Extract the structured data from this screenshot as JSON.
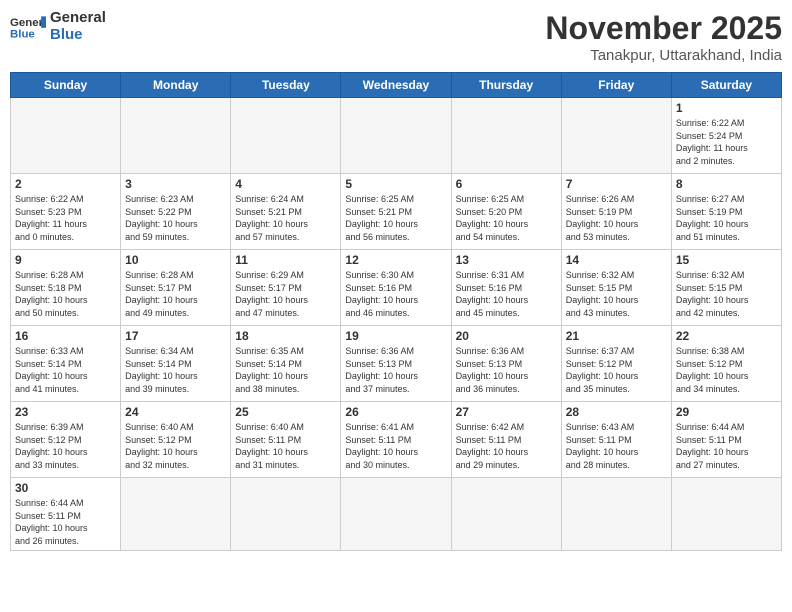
{
  "header": {
    "logo_general": "General",
    "logo_blue": "Blue",
    "month_title": "November 2025",
    "subtitle": "Tanakpur, Uttarakhand, India"
  },
  "weekdays": [
    "Sunday",
    "Monday",
    "Tuesday",
    "Wednesday",
    "Thursday",
    "Friday",
    "Saturday"
  ],
  "days": [
    {
      "num": "",
      "info": ""
    },
    {
      "num": "",
      "info": ""
    },
    {
      "num": "",
      "info": ""
    },
    {
      "num": "",
      "info": ""
    },
    {
      "num": "",
      "info": ""
    },
    {
      "num": "",
      "info": ""
    },
    {
      "num": "1",
      "info": "Sunrise: 6:22 AM\nSunset: 5:24 PM\nDaylight: 11 hours\nand 2 minutes."
    },
    {
      "num": "2",
      "info": "Sunrise: 6:22 AM\nSunset: 5:23 PM\nDaylight: 11 hours\nand 0 minutes."
    },
    {
      "num": "3",
      "info": "Sunrise: 6:23 AM\nSunset: 5:22 PM\nDaylight: 10 hours\nand 59 minutes."
    },
    {
      "num": "4",
      "info": "Sunrise: 6:24 AM\nSunset: 5:21 PM\nDaylight: 10 hours\nand 57 minutes."
    },
    {
      "num": "5",
      "info": "Sunrise: 6:25 AM\nSunset: 5:21 PM\nDaylight: 10 hours\nand 56 minutes."
    },
    {
      "num": "6",
      "info": "Sunrise: 6:25 AM\nSunset: 5:20 PM\nDaylight: 10 hours\nand 54 minutes."
    },
    {
      "num": "7",
      "info": "Sunrise: 6:26 AM\nSunset: 5:19 PM\nDaylight: 10 hours\nand 53 minutes."
    },
    {
      "num": "8",
      "info": "Sunrise: 6:27 AM\nSunset: 5:19 PM\nDaylight: 10 hours\nand 51 minutes."
    },
    {
      "num": "9",
      "info": "Sunrise: 6:28 AM\nSunset: 5:18 PM\nDaylight: 10 hours\nand 50 minutes."
    },
    {
      "num": "10",
      "info": "Sunrise: 6:28 AM\nSunset: 5:17 PM\nDaylight: 10 hours\nand 49 minutes."
    },
    {
      "num": "11",
      "info": "Sunrise: 6:29 AM\nSunset: 5:17 PM\nDaylight: 10 hours\nand 47 minutes."
    },
    {
      "num": "12",
      "info": "Sunrise: 6:30 AM\nSunset: 5:16 PM\nDaylight: 10 hours\nand 46 minutes."
    },
    {
      "num": "13",
      "info": "Sunrise: 6:31 AM\nSunset: 5:16 PM\nDaylight: 10 hours\nand 45 minutes."
    },
    {
      "num": "14",
      "info": "Sunrise: 6:32 AM\nSunset: 5:15 PM\nDaylight: 10 hours\nand 43 minutes."
    },
    {
      "num": "15",
      "info": "Sunrise: 6:32 AM\nSunset: 5:15 PM\nDaylight: 10 hours\nand 42 minutes."
    },
    {
      "num": "16",
      "info": "Sunrise: 6:33 AM\nSunset: 5:14 PM\nDaylight: 10 hours\nand 41 minutes."
    },
    {
      "num": "17",
      "info": "Sunrise: 6:34 AM\nSunset: 5:14 PM\nDaylight: 10 hours\nand 39 minutes."
    },
    {
      "num": "18",
      "info": "Sunrise: 6:35 AM\nSunset: 5:14 PM\nDaylight: 10 hours\nand 38 minutes."
    },
    {
      "num": "19",
      "info": "Sunrise: 6:36 AM\nSunset: 5:13 PM\nDaylight: 10 hours\nand 37 minutes."
    },
    {
      "num": "20",
      "info": "Sunrise: 6:36 AM\nSunset: 5:13 PM\nDaylight: 10 hours\nand 36 minutes."
    },
    {
      "num": "21",
      "info": "Sunrise: 6:37 AM\nSunset: 5:12 PM\nDaylight: 10 hours\nand 35 minutes."
    },
    {
      "num": "22",
      "info": "Sunrise: 6:38 AM\nSunset: 5:12 PM\nDaylight: 10 hours\nand 34 minutes."
    },
    {
      "num": "23",
      "info": "Sunrise: 6:39 AM\nSunset: 5:12 PM\nDaylight: 10 hours\nand 33 minutes."
    },
    {
      "num": "24",
      "info": "Sunrise: 6:40 AM\nSunset: 5:12 PM\nDaylight: 10 hours\nand 32 minutes."
    },
    {
      "num": "25",
      "info": "Sunrise: 6:40 AM\nSunset: 5:11 PM\nDaylight: 10 hours\nand 31 minutes."
    },
    {
      "num": "26",
      "info": "Sunrise: 6:41 AM\nSunset: 5:11 PM\nDaylight: 10 hours\nand 30 minutes."
    },
    {
      "num": "27",
      "info": "Sunrise: 6:42 AM\nSunset: 5:11 PM\nDaylight: 10 hours\nand 29 minutes."
    },
    {
      "num": "28",
      "info": "Sunrise: 6:43 AM\nSunset: 5:11 PM\nDaylight: 10 hours\nand 28 minutes."
    },
    {
      "num": "29",
      "info": "Sunrise: 6:44 AM\nSunset: 5:11 PM\nDaylight: 10 hours\nand 27 minutes."
    },
    {
      "num": "30",
      "info": "Sunrise: 6:44 AM\nSunset: 5:11 PM\nDaylight: 10 hours\nand 26 minutes."
    },
    {
      "num": "",
      "info": ""
    },
    {
      "num": "",
      "info": ""
    },
    {
      "num": "",
      "info": ""
    },
    {
      "num": "",
      "info": ""
    },
    {
      "num": "",
      "info": ""
    }
  ]
}
